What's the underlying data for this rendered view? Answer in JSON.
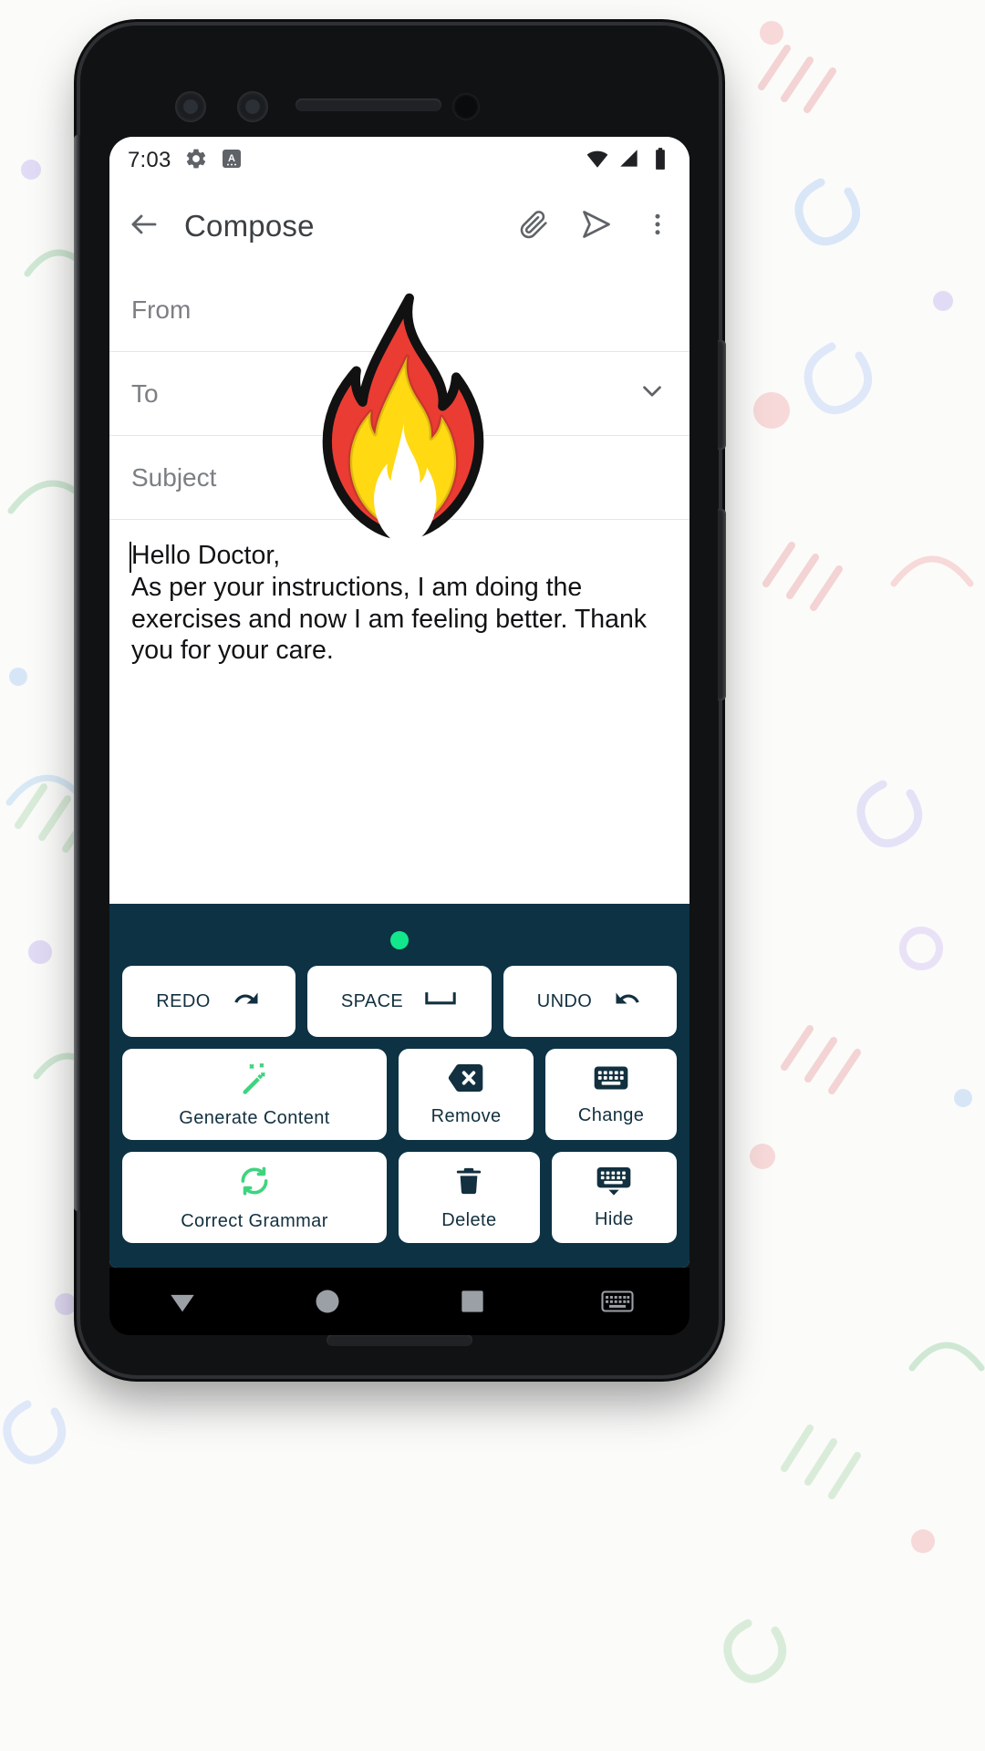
{
  "status_bar": {
    "time": "7:03",
    "icons_left": [
      "gear-icon",
      "a-badge-icon"
    ],
    "icons_right": [
      "wifi-icon",
      "signal-icon",
      "battery-icon"
    ]
  },
  "app_bar": {
    "back_label": "back-arrow",
    "title": "Compose",
    "actions": [
      "attach-icon",
      "send-icon",
      "overflow-menu-icon"
    ]
  },
  "compose_form": {
    "from": {
      "label": "From",
      "value": ""
    },
    "to": {
      "label": "To",
      "value": "",
      "expand_icon": "chevron-down-icon"
    },
    "subject": {
      "label": "Subject",
      "value": ""
    },
    "body": {
      "value": "Hello Doctor,\nAs per your instructions, I am doing the exercises and now I am feeling better. Thank you for your care."
    }
  },
  "overlay": {
    "emoji": "fire-emoji",
    "colors": {
      "outer": "#ea3c33",
      "inner": "#ffd912",
      "highlight": "#ffffff",
      "outline": "#000000"
    }
  },
  "toolbar": {
    "background": "#0c3244",
    "indicator_color": "#12e78c",
    "accent_green": "#3ed47f",
    "rows": [
      [
        {
          "label": "REDO",
          "icon": "redo-arrow-icon"
        },
        {
          "label": "SPACE",
          "icon": "spacebar-icon"
        },
        {
          "label": "UNDO",
          "icon": "undo-arrow-icon"
        }
      ],
      [
        {
          "label": "Generate Content",
          "icon": "magic-wand-icon"
        },
        {
          "label": "Remove",
          "icon": "backspace-icon"
        },
        {
          "label": "Change",
          "icon": "keyboard-icon"
        }
      ],
      [
        {
          "label": "Correct Grammar",
          "icon": "refresh-sync-icon"
        },
        {
          "label": "Delete",
          "icon": "trash-icon"
        },
        {
          "label": "Hide",
          "icon": "keyboard-hide-icon"
        }
      ]
    ]
  },
  "nav_bar": {
    "items": [
      "back-triangle-icon",
      "home-circle-icon",
      "recents-square-icon",
      "keyboard-switch-icon"
    ]
  }
}
